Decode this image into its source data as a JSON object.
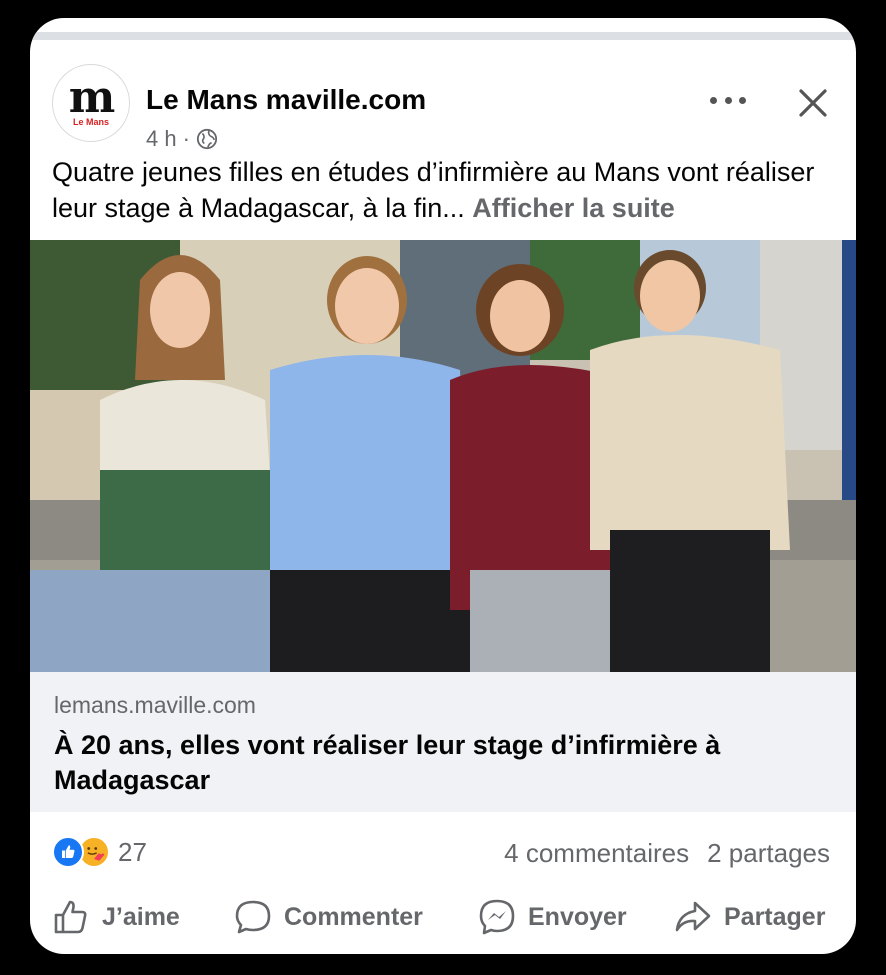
{
  "post": {
    "page_name": "Le Mans maville.com",
    "avatar_logo": "m",
    "avatar_sub": "Le Mans",
    "time": "4 h",
    "separator": "·",
    "text": "Quatre jeunes filles en études d’infirmière au Mans vont réaliser leur stage à Madagascar, à la fin...",
    "see_more": "Afficher la suite",
    "icons": {
      "privacy": "globe-icon",
      "more": "more-options-icon",
      "close": "close-icon"
    }
  },
  "link_preview": {
    "domain": "lemans.maville.com",
    "title": "À 20 ans, elles vont réaliser leur stage d’infirmière à Madagascar"
  },
  "stats": {
    "reaction_count": "27",
    "comments": "4 commentaires",
    "shares": "2 partages",
    "reaction_icons": [
      "like-reaction-icon",
      "care-reaction-icon"
    ]
  },
  "actions": {
    "like": "J’aime",
    "comment": "Commenter",
    "send": "Envoyer",
    "share": "Partager"
  },
  "colors": {
    "background": "#000000",
    "card": "#ffffff",
    "secondary_text": "#65676b",
    "link_box": "#f0f2f5",
    "like_blue": "#1877f2"
  }
}
